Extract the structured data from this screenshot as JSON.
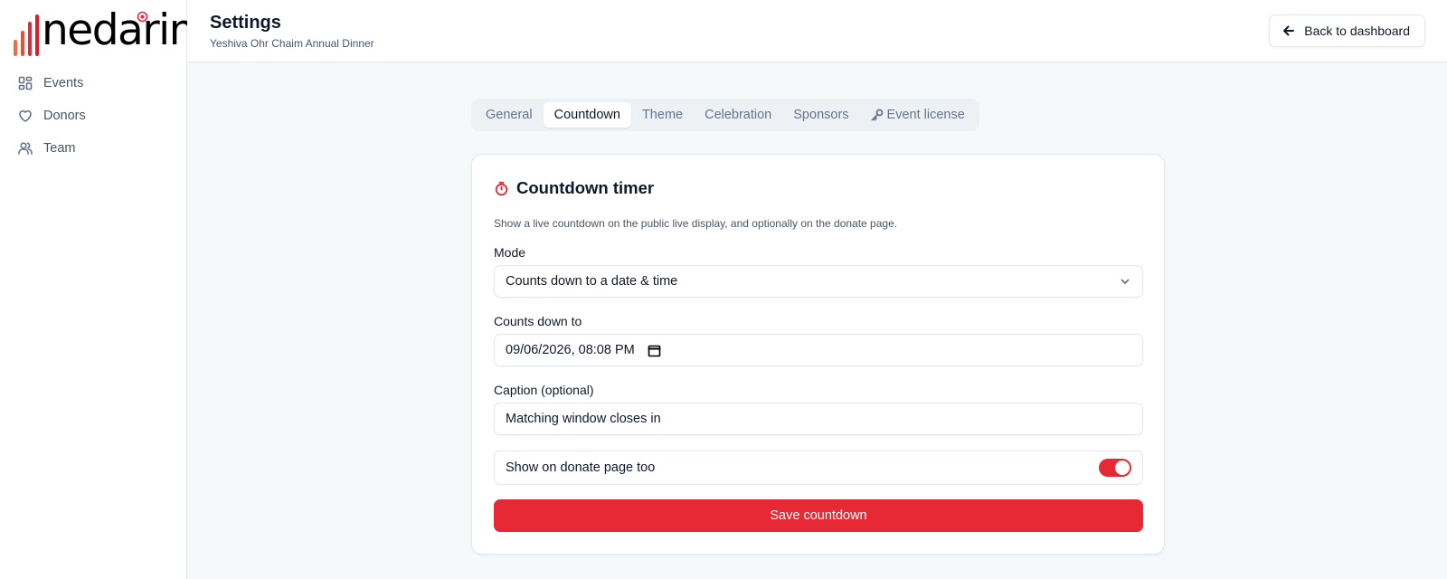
{
  "brand": {
    "name": "nedarim",
    "accent": "#e62934"
  },
  "sidebar": {
    "items": [
      {
        "label": "Events",
        "icon": "dashboard-grid-icon"
      },
      {
        "label": "Donors",
        "icon": "heart-icon"
      },
      {
        "label": "Team",
        "icon": "users-icon"
      }
    ]
  },
  "header": {
    "title": "Settings",
    "subtitle": "Yeshiva Ohr Chaim Annual Dinner",
    "back_label": "Back to dashboard"
  },
  "tabs": [
    {
      "label": "General",
      "active": false
    },
    {
      "label": "Countdown",
      "active": true
    },
    {
      "label": "Theme",
      "active": false
    },
    {
      "label": "Celebration",
      "active": false
    },
    {
      "label": "Sponsors",
      "active": false
    },
    {
      "label": "Event license",
      "active": false,
      "icon": "key-icon"
    }
  ],
  "card": {
    "title": "Countdown timer",
    "description": "Show a live countdown on the public live display, and optionally on the donate page.",
    "mode": {
      "label": "Mode",
      "value": "Counts down to a date & time"
    },
    "target": {
      "label": "Counts down to",
      "value": "09/06/2026, 08:08 PM"
    },
    "caption": {
      "label": "Caption (optional)",
      "value": "Matching window closes in"
    },
    "show_on_donate": {
      "label": "Show on donate page too",
      "enabled": true
    },
    "save_label": "Save countdown"
  }
}
